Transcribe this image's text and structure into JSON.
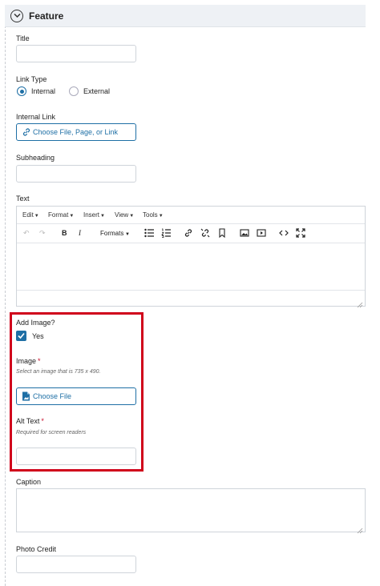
{
  "section": {
    "title": "Feature"
  },
  "fields": {
    "title": {
      "label": "Title",
      "value": ""
    },
    "link_type": {
      "label": "Link Type",
      "options": [
        "Internal",
        "External"
      ],
      "selected": "Internal"
    },
    "internal_link": {
      "label": "Internal Link",
      "button": "Choose File, Page, or Link"
    },
    "subheading": {
      "label": "Subheading",
      "value": ""
    },
    "text": {
      "label": "Text",
      "menus": [
        "Edit",
        "Format",
        "Insert",
        "View",
        "Tools"
      ],
      "formats_label": "Formats"
    },
    "add_image": {
      "label": "Add Image?",
      "checkbox_label": "Yes",
      "checked": true
    },
    "image": {
      "label": "Image",
      "required": "*",
      "hint": "Select an image that is 735 x 490.",
      "button": "Choose File"
    },
    "alt_text": {
      "label": "Alt Text",
      "required": "*",
      "hint": "Required for screen readers",
      "value": ""
    },
    "caption": {
      "label": "Caption",
      "value": ""
    },
    "photo_credit": {
      "label": "Photo Credit",
      "value": ""
    }
  },
  "icons": {
    "collapse": "chevron-down-icon",
    "link": "link-icon",
    "file": "file-icon",
    "undo": "undo-icon",
    "redo": "redo-icon",
    "bold": "bold-icon",
    "italic": "italic-icon",
    "bullet_list": "bullet-list-icon",
    "numbered_list": "numbered-list-icon",
    "insert_link": "insert-link-icon",
    "unlink": "unlink-icon",
    "anchor": "bookmark-icon",
    "image": "image-icon",
    "media": "media-icon",
    "code": "code-icon",
    "fullscreen": "fullscreen-icon"
  },
  "colors": {
    "accent": "#1e6fa5",
    "highlight_border": "#d0021b",
    "required": "#c8102e",
    "header_bg": "#eef1f5"
  }
}
